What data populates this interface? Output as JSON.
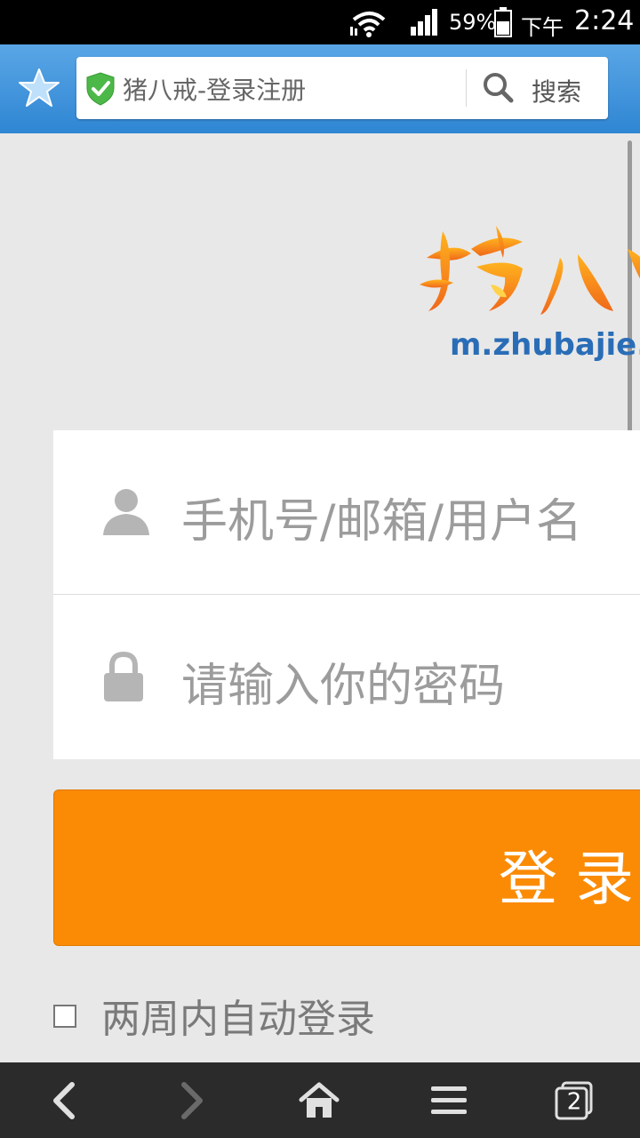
{
  "status_bar": {
    "battery_percent": "59%",
    "am_pm": "下午",
    "time": "2:24"
  },
  "toolbar": {
    "page_title": "猪八戒-登录注册",
    "search_label": "搜索"
  },
  "logo": {
    "url_text": "m.zhubajie."
  },
  "login_form": {
    "username_placeholder": "手机号/邮箱/用户名",
    "password_placeholder": "请输入你的密码",
    "login_button_label": "登录",
    "remember_label": "两周内自动登录",
    "remember_checked": false
  },
  "bottom_nav": {
    "tab_count": "2"
  },
  "colors": {
    "toolbar_blue": "#2f86d3",
    "login_orange": "#fb8b05",
    "logo_blue": "#2a6db7"
  }
}
